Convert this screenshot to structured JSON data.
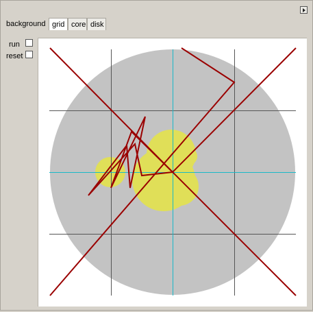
{
  "toolbar": {
    "background_label": "background",
    "tabs": [
      {
        "label": "grid",
        "active": true
      },
      {
        "label": "core",
        "active": false
      },
      {
        "label": "disk",
        "active": false
      }
    ]
  },
  "controls": {
    "run_label": "run",
    "run_checked": false,
    "reset_label": "reset",
    "reset_checked": false
  },
  "colors": {
    "window_bg": "#d6d2ca",
    "canvas_bg": "#ffffff",
    "disk_fill": "#c3c3c3",
    "core_fill": "#e0df58",
    "grid_line": "#555555",
    "axis_line": "#19b8c8",
    "path_line": "#9a0000"
  },
  "icons": {
    "corner": "expand-arrow-icon"
  }
}
